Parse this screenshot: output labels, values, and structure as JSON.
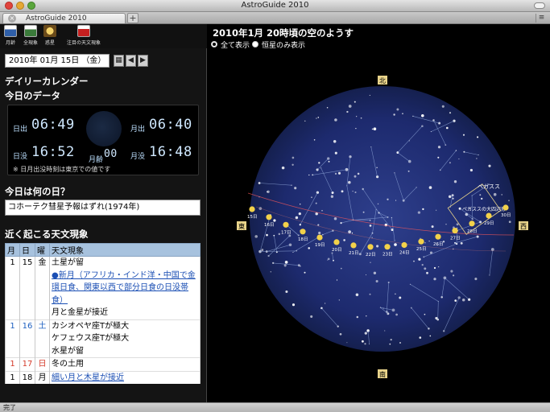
{
  "window": {
    "title": "AstroGuide 2010"
  },
  "tabbar": {
    "tab_label": "AstroGuide 2010",
    "close_glyph": "×",
    "add_glyph": "+",
    "menu_glyph": "≡"
  },
  "toolbar": {
    "items": [
      {
        "label": "月齢",
        "icon": "calendar-icon"
      },
      {
        "label": "全現象",
        "icon": "calendar-icon"
      },
      {
        "label": "惑星",
        "icon": "planet-icon"
      },
      {
        "label": "注目の天文現象",
        "icon": "alert-icon"
      }
    ]
  },
  "date_picker": {
    "value": "2010年 01月 15日 （金）",
    "cal_glyph": "▦",
    "prev_glyph": "◀",
    "next_glyph": "▶"
  },
  "daily": {
    "heading": "デイリーカレンダー",
    "data_heading": "今日のデータ",
    "sunrise_label": "日出",
    "sunrise": "06:49",
    "moonrise_label": "月出",
    "moonrise": "06:40",
    "sunset_label": "日没",
    "sunset": "16:52",
    "moonage_label": "月齢",
    "moonage": "00",
    "moonset_label": "月没",
    "moonset": "16:48",
    "note": "※ 日月出没時刻は東京での値です"
  },
  "trivia": {
    "heading": "今日は何の日？",
    "text": "コホーテク彗星予報はずれ(1974年)"
  },
  "events": {
    "heading": "近く起こる天文現象",
    "columns": [
      "月",
      "日",
      "曜",
      "天文現象"
    ],
    "rows": [
      {
        "month": "1",
        "day": "15",
        "weekday": "金",
        "text": "土星が留",
        "style": "normal"
      },
      {
        "month": "",
        "day": "",
        "weekday": "",
        "text": "●新月（アフリカ・インド洋・中国で金環日食、関東以西で部分日食の日没帯食）",
        "style": "link"
      },
      {
        "month": "",
        "day": "",
        "weekday": "",
        "text": "月と金星が接近",
        "style": "normal"
      },
      {
        "month": "1",
        "day": "16",
        "weekday": "土",
        "text": "カシオペヤ座Tが極大",
        "style": "blue"
      },
      {
        "month": "",
        "day": "",
        "weekday": "",
        "text": "ケフェウス座Tが極大",
        "style": "normal"
      },
      {
        "month": "",
        "day": "",
        "weekday": "",
        "text": "水星が留",
        "style": "normal"
      },
      {
        "month": "1",
        "day": "17",
        "weekday": "日",
        "text": "冬の土用",
        "style": "red"
      },
      {
        "month": "1",
        "day": "18",
        "weekday": "月",
        "text": "細い月と木星が接近",
        "style": "link"
      }
    ]
  },
  "sky": {
    "title": "2010年1月 20時頃の空のようす",
    "option_all": "全て表示",
    "option_stars": "恒星のみ表示",
    "dir_north": "北",
    "dir_south": "南",
    "dir_east": "東",
    "dir_west": "西",
    "pegasus_label": "ペガスス",
    "pegasus_square": "ペガススの大四辺形",
    "moon_dates": [
      "15日",
      "16日",
      "17日",
      "18日",
      "19日",
      "20日",
      "21日",
      "22日",
      "23日",
      "24日",
      "25日",
      "26日",
      "27日",
      "28日",
      "29日",
      "30日"
    ]
  },
  "status": {
    "text": "完了"
  },
  "colors": {
    "sky_bg": "#1a2a6a",
    "header_blue": "#a7c2de",
    "link": "#1b4fb4",
    "sunday": "#d43a2a",
    "saturday": "#1d5fc0"
  }
}
